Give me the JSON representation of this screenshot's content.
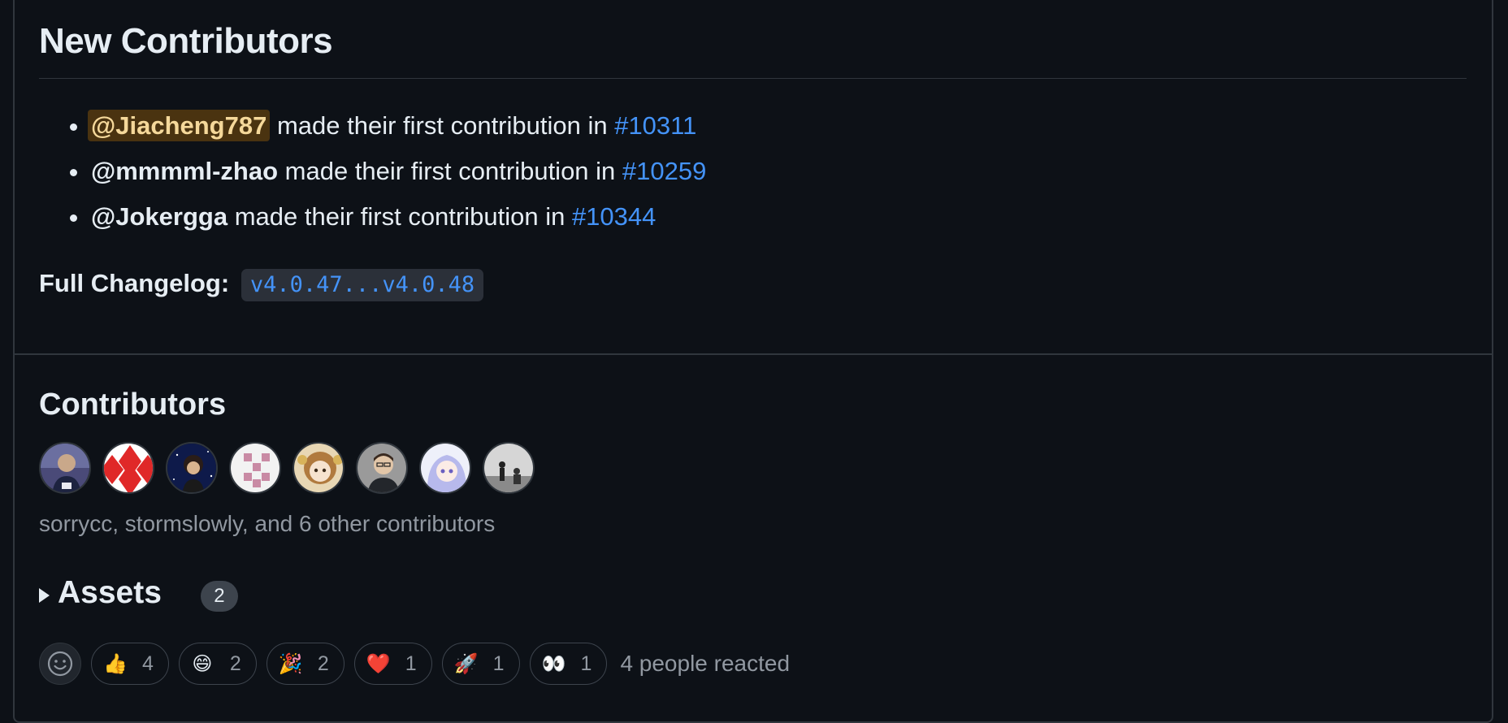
{
  "new_contributors": {
    "title": "New Contributors",
    "items": [
      {
        "user": "@Jiacheng787",
        "text": " made their first contribution in ",
        "pr": "#10311"
      },
      {
        "user": "@mmmml-zhao",
        "text": " made their first contribution in ",
        "pr": "#10259"
      },
      {
        "user": "@Jokergga",
        "text": " made their first contribution in ",
        "pr": "#10344"
      }
    ]
  },
  "changelog": {
    "label": "Full Changelog:",
    "range": "v4.0.47...v4.0.48"
  },
  "contributors": {
    "title": "Contributors",
    "summary": "sorrycc, stormslowly, and 6 other contributors",
    "avatar_count": 8
  },
  "assets": {
    "label": "Assets",
    "count": "2"
  },
  "reactions": {
    "items": [
      {
        "emoji": "👍",
        "count": "4"
      },
      {
        "emoji": "😄",
        "count": "2"
      },
      {
        "emoji": "🎉",
        "count": "2"
      },
      {
        "emoji": "❤️",
        "count": "1"
      },
      {
        "emoji": "🚀",
        "count": "1"
      },
      {
        "emoji": "👀",
        "count": "1"
      }
    ],
    "summary": "4 people reacted"
  },
  "colors": {
    "background": "#0d1117",
    "border": "#30363d",
    "link": "#4493f8",
    "muted": "#9198a1",
    "highlight_bg": "#4a3310"
  }
}
